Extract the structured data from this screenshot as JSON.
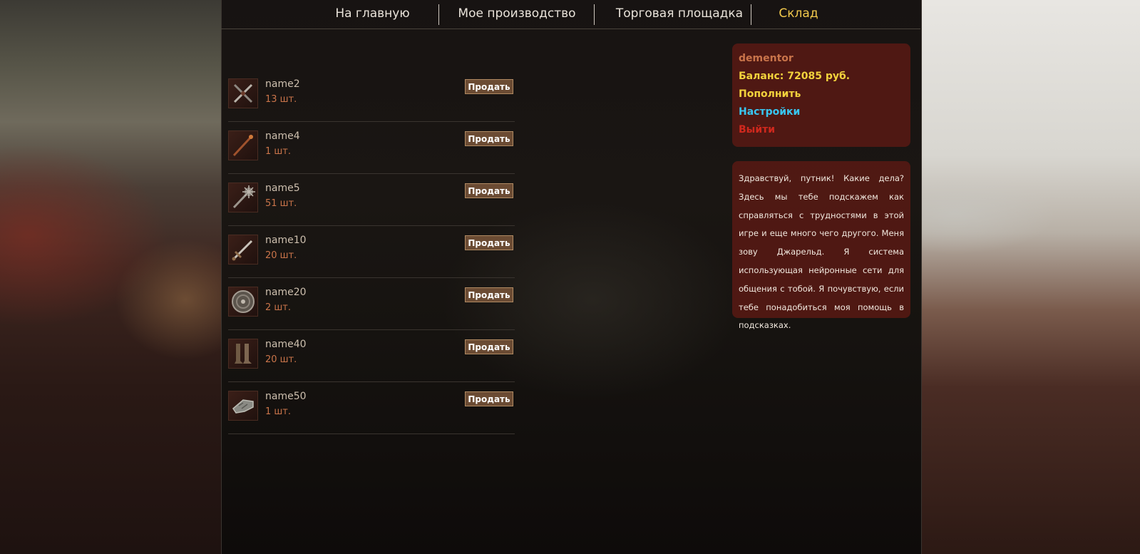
{
  "nav": {
    "items": [
      {
        "label": "На главную"
      },
      {
        "label": "Мое производство"
      },
      {
        "label": "Торговая площадка"
      },
      {
        "label": "Склад"
      }
    ],
    "active_color": "#f2c94c"
  },
  "inventory": {
    "sell_label": "Продать",
    "items": [
      {
        "name": "name2",
        "qty": "13 шт.",
        "icon": "crossed-daggers-icon"
      },
      {
        "name": "name4",
        "qty": "1 шт.",
        "icon": "staff-icon"
      },
      {
        "name": "name5",
        "qty": "51 шт.",
        "icon": "mace-icon"
      },
      {
        "name": "name10",
        "qty": "20 шт.",
        "icon": "sword-icon"
      },
      {
        "name": "name20",
        "qty": "2 шт.",
        "icon": "shield-icon"
      },
      {
        "name": "name40",
        "qty": "20 шт.",
        "icon": "boots-icon"
      },
      {
        "name": "name50",
        "qty": "1 шт.",
        "icon": "gauntlet-icon"
      }
    ]
  },
  "user": {
    "username": "dementor",
    "balance": "Баланс: 72085 руб.",
    "topup": "Пополнить",
    "settings": "Настройки",
    "logout": "Выйти"
  },
  "assistant": {
    "text": "Здравствуй, путник! Какие дела? Здесь мы тебе подскажем как справляться с трудностями в этой игре и еще много чего другого. Меня зову Джарельд. Я система использующая нейронные сети для общения с тобой. Я почувствую, если тебе понадобиться моя помощь в подсказках."
  },
  "colors": {
    "accent": "#f2d23c",
    "settings": "#38c6f2",
    "logout": "#d0281d",
    "quantity": "#c9744a",
    "panel": "#5c1a14"
  }
}
